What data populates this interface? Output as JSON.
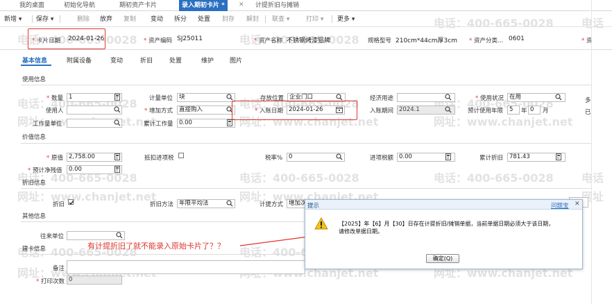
{
  "tabs": [
    {
      "label": "我的桌面"
    },
    {
      "label": "初始化导航"
    },
    {
      "label": "期初资产卡片"
    },
    {
      "label": "录入期初卡片 *"
    },
    {
      "label": "计提折旧与摊销"
    }
  ],
  "toolbar": {
    "new": "新增",
    "save": "保存",
    "delete": "删除",
    "abandon": "放弃",
    "copy": "复制",
    "change": "变动",
    "split": "拆分",
    "dispose": "处置",
    "seal": "封存",
    "unseal": "解封",
    "link": "联查",
    "print": "打印",
    "more": "更多"
  },
  "header": {
    "card_date_label": "卡片日期",
    "card_date": "2024-01-26",
    "asset_code_label": "资产编码",
    "asset_code": "SJ25011",
    "asset_name_label": "资产名称",
    "asset_name": "不锈钢烤漆铝牌",
    "spec_label": "规格型号",
    "spec": "210cm*44cm厚3cm",
    "category_label": "资产分类...",
    "category": "0601",
    "more_label": "资"
  },
  "subtabs": [
    "基本信息",
    "附属设备",
    "变动",
    "折旧",
    "处置",
    "维护",
    "图片"
  ],
  "sections": {
    "usage": "使用信息",
    "value": "价值信息",
    "depreciation": "折旧信息",
    "other": "其他信息",
    "card": "建卡信息"
  },
  "usage": {
    "qty_label": "数量",
    "qty": "1",
    "unit_label": "计量单位",
    "unit": "块",
    "location_label": "存放位置",
    "location": "企业门口",
    "econ_use_label": "经济用途",
    "econ_use": "",
    "status_label": "使用状况",
    "status": "在用",
    "extra_label": "多",
    "user_label": "使用人",
    "user": "",
    "add_method_label": "增加方式",
    "add_method": "直接购入",
    "entry_date_label": "入账日期",
    "entry_date": "2024-01-26",
    "entry_period_label": "入账期间",
    "entry_period": "2024.1",
    "life_label": "预计使用年限",
    "life_years": "5",
    "year_unit": "年",
    "life_months": "0",
    "month_unit": "月",
    "extra2_label": "已",
    "workload_unit_label": "工作量单位",
    "workload_unit": "",
    "total_workload_label": "累计工作量",
    "total_workload": "0.00"
  },
  "value": {
    "orig_label": "原值",
    "orig": "2,758.00",
    "deduct_tax_label": "抵扣进项税",
    "tax_rate_label": "税率%",
    "tax_rate": "0",
    "input_tax_label": "进项税额",
    "input_tax": "0.00",
    "accum_dep_label": "累计折旧",
    "accum_dep": "781.43",
    "salvage_label": "预计净残值",
    "salvage": "0.00"
  },
  "depreciation": {
    "dep_label": "折旧",
    "method_label": "折旧方法",
    "method": "年限平均法",
    "calc_label": "计提方式",
    "calc": "增加次"
  },
  "other": {
    "partner_label": "往来单位",
    "partner": ""
  },
  "card": {
    "note_label": "备注",
    "note": "",
    "print_count_label": "打印次数",
    "print_count": "0"
  },
  "annotation": "有计提折旧了就不能录入原始卡片了？？",
  "dialog": {
    "title": "提示",
    "help": "问题宝",
    "message_line1": "【2025】年【6】月【30】日存在计提折旧/摊销单据，当前单据日期必须大于该日期，",
    "message_line2": "请修改单据日期。",
    "ok": "确定(Q)"
  },
  "watermark": {
    "phone": "电话：400-665-0028",
    "site": "网址：www.chanjet.net",
    "phone_short": "电话",
    "site_short": "网址"
  },
  "colors": {
    "accent": "#2a6fc1",
    "annotation": "#e0332e"
  }
}
